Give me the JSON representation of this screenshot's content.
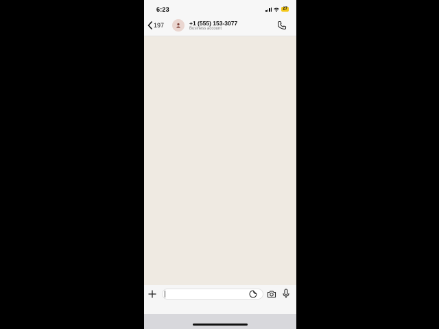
{
  "status_bar": {
    "time": "6:23",
    "battery": "27"
  },
  "header": {
    "back_count": "197",
    "contact_name": "+1 (555) 153-3077",
    "contact_subtitle": "Business account"
  },
  "input": {
    "placeholder": "",
    "value": ""
  },
  "icons": {
    "back": "chevron-left-icon",
    "avatar": "person-icon",
    "call": "phone-icon",
    "attach": "plus-icon",
    "sticker": "sticker-icon",
    "camera": "camera-icon",
    "mic": "microphone-icon"
  },
  "colors": {
    "chat_background": "#efeae2",
    "bar_background": "#f7f7f7",
    "battery": "#f4c81b",
    "avatar_background": "#ead6d0"
  }
}
